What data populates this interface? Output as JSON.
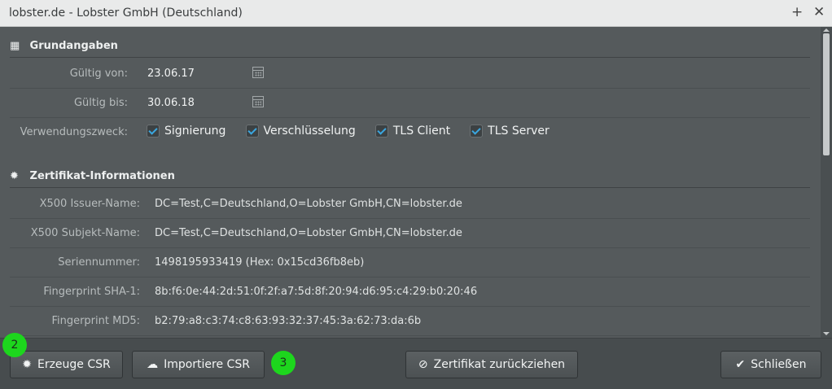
{
  "window": {
    "title": "lobster.de - Lobster GmbH (Deutschland)",
    "maximize_icon": "+",
    "close_icon": "✕"
  },
  "grundangaben": {
    "heading": "Grundangaben",
    "gueltig_von_label": "Gültig von:",
    "gueltig_von_value": "23.06.17",
    "gueltig_bis_label": "Gültig bis:",
    "gueltig_bis_value": "30.06.18",
    "verwendungszweck_label": "Verwendungszweck:",
    "checkboxes": [
      {
        "label": "Signierung",
        "checked": true
      },
      {
        "label": "Verschlüsselung",
        "checked": true
      },
      {
        "label": "TLS Client",
        "checked": true
      },
      {
        "label": "TLS Server",
        "checked": true
      }
    ]
  },
  "zertifikat": {
    "heading": "Zertifikat-Informationen",
    "rows": [
      {
        "label": "X500 Issuer-Name:",
        "value": "DC=Test,C=Deutschland,O=Lobster GmbH,CN=lobster.de"
      },
      {
        "label": "X500 Subjekt-Name:",
        "value": "DC=Test,C=Deutschland,O=Lobster GmbH,CN=lobster.de"
      },
      {
        "label": "Seriennummer:",
        "value": "1498195933419 (Hex: 0x15cd36fb8eb)"
      },
      {
        "label": "Fingerprint SHA-1:",
        "value": "8b:f6:0e:44:2d:51:0f:2f:a7:5d:8f:20:94:d6:95:c4:29:b0:20:46"
      },
      {
        "label": "Fingerprint MD5:",
        "value": "b2:79:a8:c3:74:c8:63:93:32:37:45:3a:62:73:da:6b"
      }
    ]
  },
  "footer": {
    "erzeuge_csr": "Erzeuge CSR",
    "importiere_csr": "Importiere CSR",
    "zurueckziehen": "Zertifikat zurückziehen",
    "schliessen": "Schließen"
  },
  "markers": {
    "m2": "2",
    "m3": "3"
  },
  "colors": {
    "marker": "#1dd61d",
    "check_accent": "#3aa7e0"
  }
}
